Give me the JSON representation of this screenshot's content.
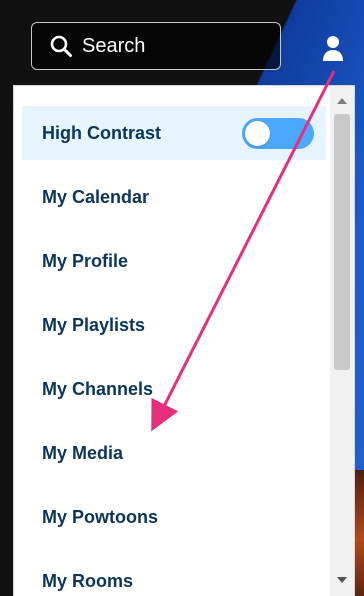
{
  "search": {
    "label": "Search"
  },
  "user_menu": {
    "items": [
      {
        "label": "High Contrast",
        "highlighted": true,
        "has_toggle": true
      },
      {
        "label": "My Calendar"
      },
      {
        "label": "My Profile"
      },
      {
        "label": "My Playlists"
      },
      {
        "label": "My Channels"
      },
      {
        "label": "My Media"
      },
      {
        "label": "My Powtoons"
      },
      {
        "label": "My Rooms"
      }
    ]
  },
  "toggle": {
    "state": "off"
  },
  "colors": {
    "menu_text": "#0b355b",
    "highlight": "#e5f4fd",
    "toggle_track": "#4aa9ff",
    "annotation": "#e62e7a"
  },
  "icons": {
    "search": "search-icon",
    "user": "user-icon",
    "scroll_up": "chevron-up-icon",
    "scroll_down": "chevron-down-icon"
  }
}
